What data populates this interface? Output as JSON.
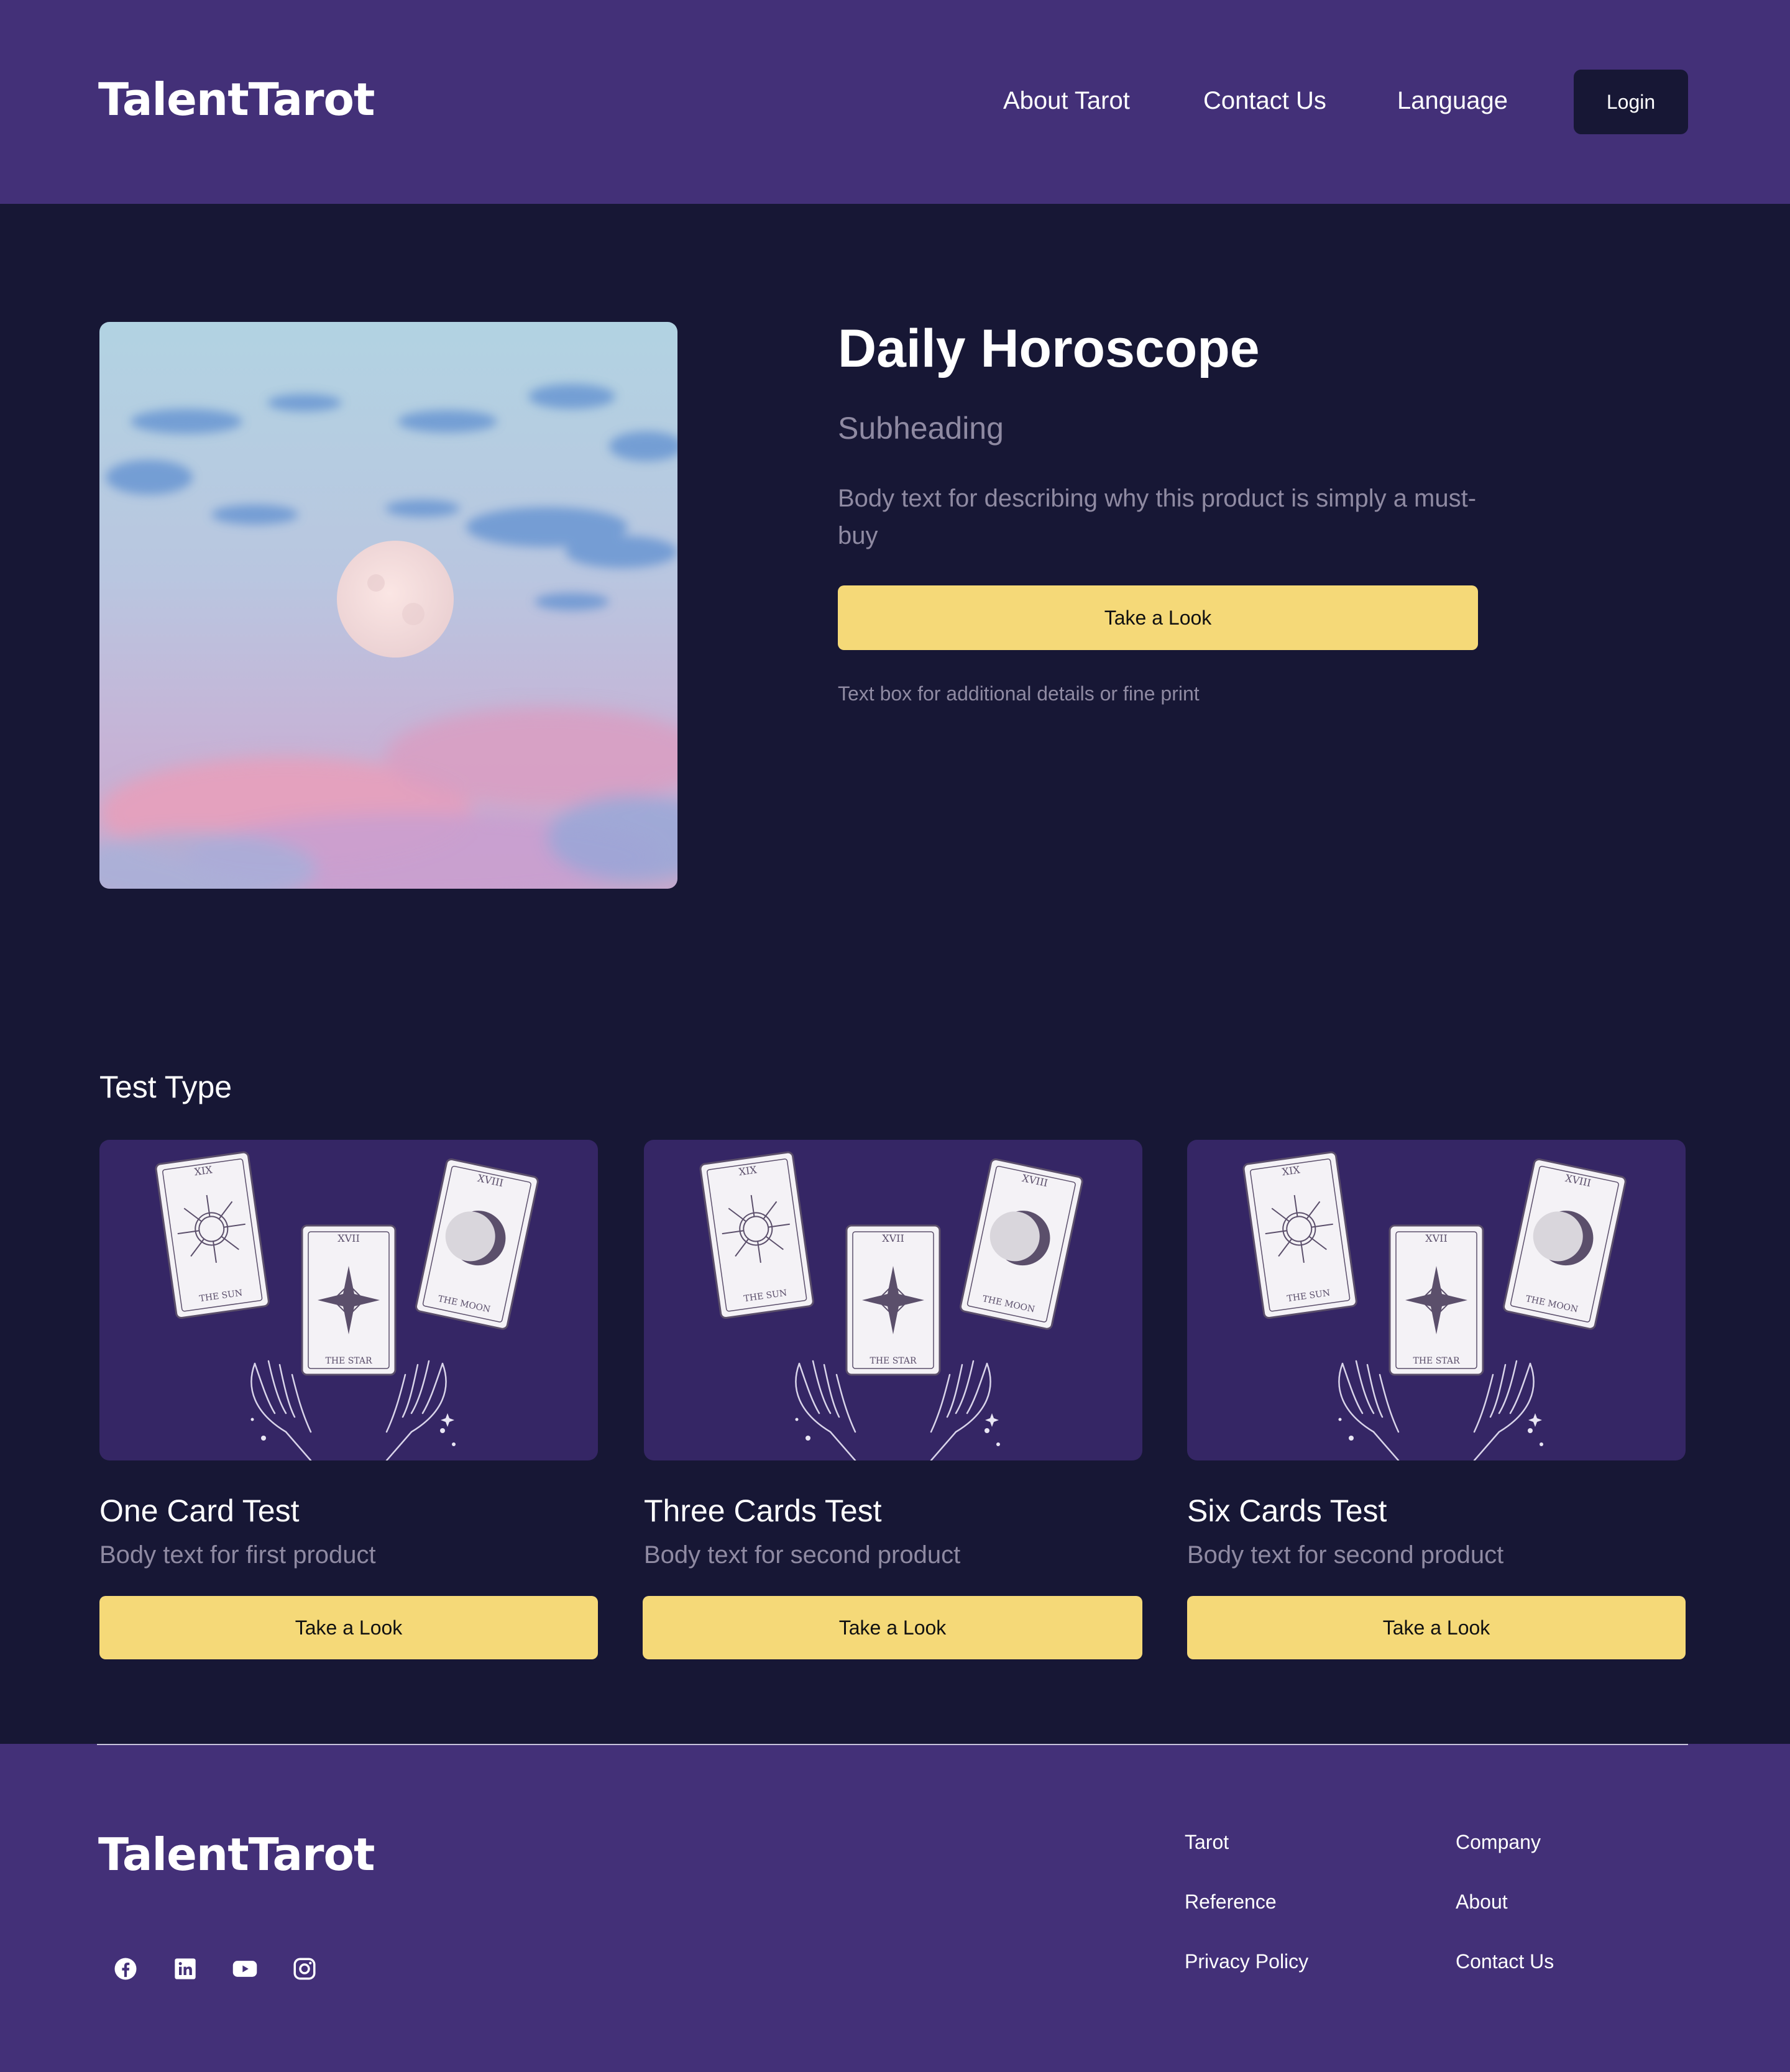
{
  "header": {
    "logo": "TalentTarot",
    "nav": [
      "About Tarot",
      "Contact Us",
      "Language"
    ],
    "login_label": "Login"
  },
  "hero": {
    "title": "Daily Horoscope",
    "subheading": "Subheading",
    "body": "Body text for describing why this product is simply a must-buy",
    "cta_label": "Take a Look",
    "fine_print": "Text box for additional details or fine print"
  },
  "tests": {
    "section_title": "Test Type",
    "cards": [
      {
        "title": "One Card Test",
        "body": "Body text for first product",
        "cta_label": "Take a Look"
      },
      {
        "title": "Three Cards Test",
        "body": "Body text for second product",
        "cta_label": "Take a Look"
      },
      {
        "title": "Six Cards Test",
        "body": "Body text for second product",
        "cta_label": "Take a Look"
      }
    ]
  },
  "footer": {
    "logo": "TalentTarot",
    "social": [
      "facebook-icon",
      "linkedin-icon",
      "youtube-icon",
      "instagram-icon"
    ],
    "col1": [
      "Tarot",
      "Reference",
      "Privacy Policy"
    ],
    "col2": [
      "Company",
      "About",
      "Contact Us"
    ]
  },
  "colors": {
    "header_bg": "#433078",
    "page_bg": "#171735",
    "card_bg": "#352665",
    "button_yellow": "#f5d978",
    "muted_text": "#8f8aa2"
  }
}
